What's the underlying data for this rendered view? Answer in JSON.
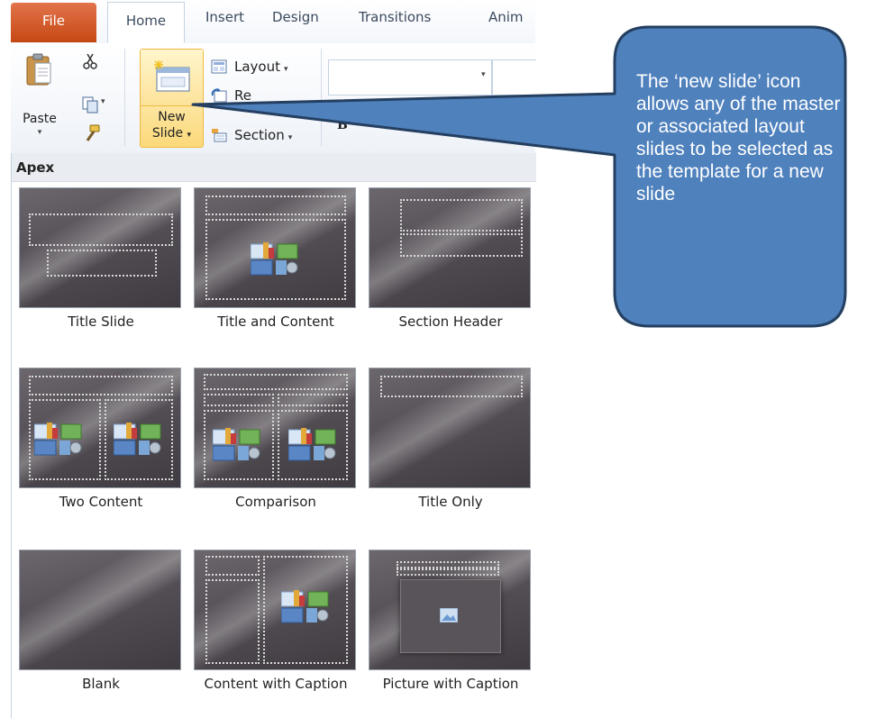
{
  "tabs": {
    "file": "File",
    "home": "Home",
    "insert": "Insert",
    "design": "Design",
    "transitions": "Transitions",
    "animations": "Anim"
  },
  "ribbon": {
    "paste": "Paste",
    "new_slide_line1": "New",
    "new_slide_line2": "Slide",
    "layout": "Layout",
    "reset": "Re",
    "section": "Section",
    "dropdown_glyph": "▾"
  },
  "gallery": {
    "theme_heading": "Apex",
    "layouts": [
      {
        "label": "Title Slide"
      },
      {
        "label": "Title and Content"
      },
      {
        "label": "Section Header"
      },
      {
        "label": "Two Content"
      },
      {
        "label": "Comparison"
      },
      {
        "label": "Title Only"
      },
      {
        "label": "Blank"
      },
      {
        "label": "Content with Caption"
      },
      {
        "label": "Picture with Caption"
      }
    ]
  },
  "callout": {
    "text": "The ‘new slide’ icon allows any of the master  or associated layout slides to be selected as the template for a new slide",
    "fill_color": "#4f81bd",
    "border_color": "#243f60"
  }
}
